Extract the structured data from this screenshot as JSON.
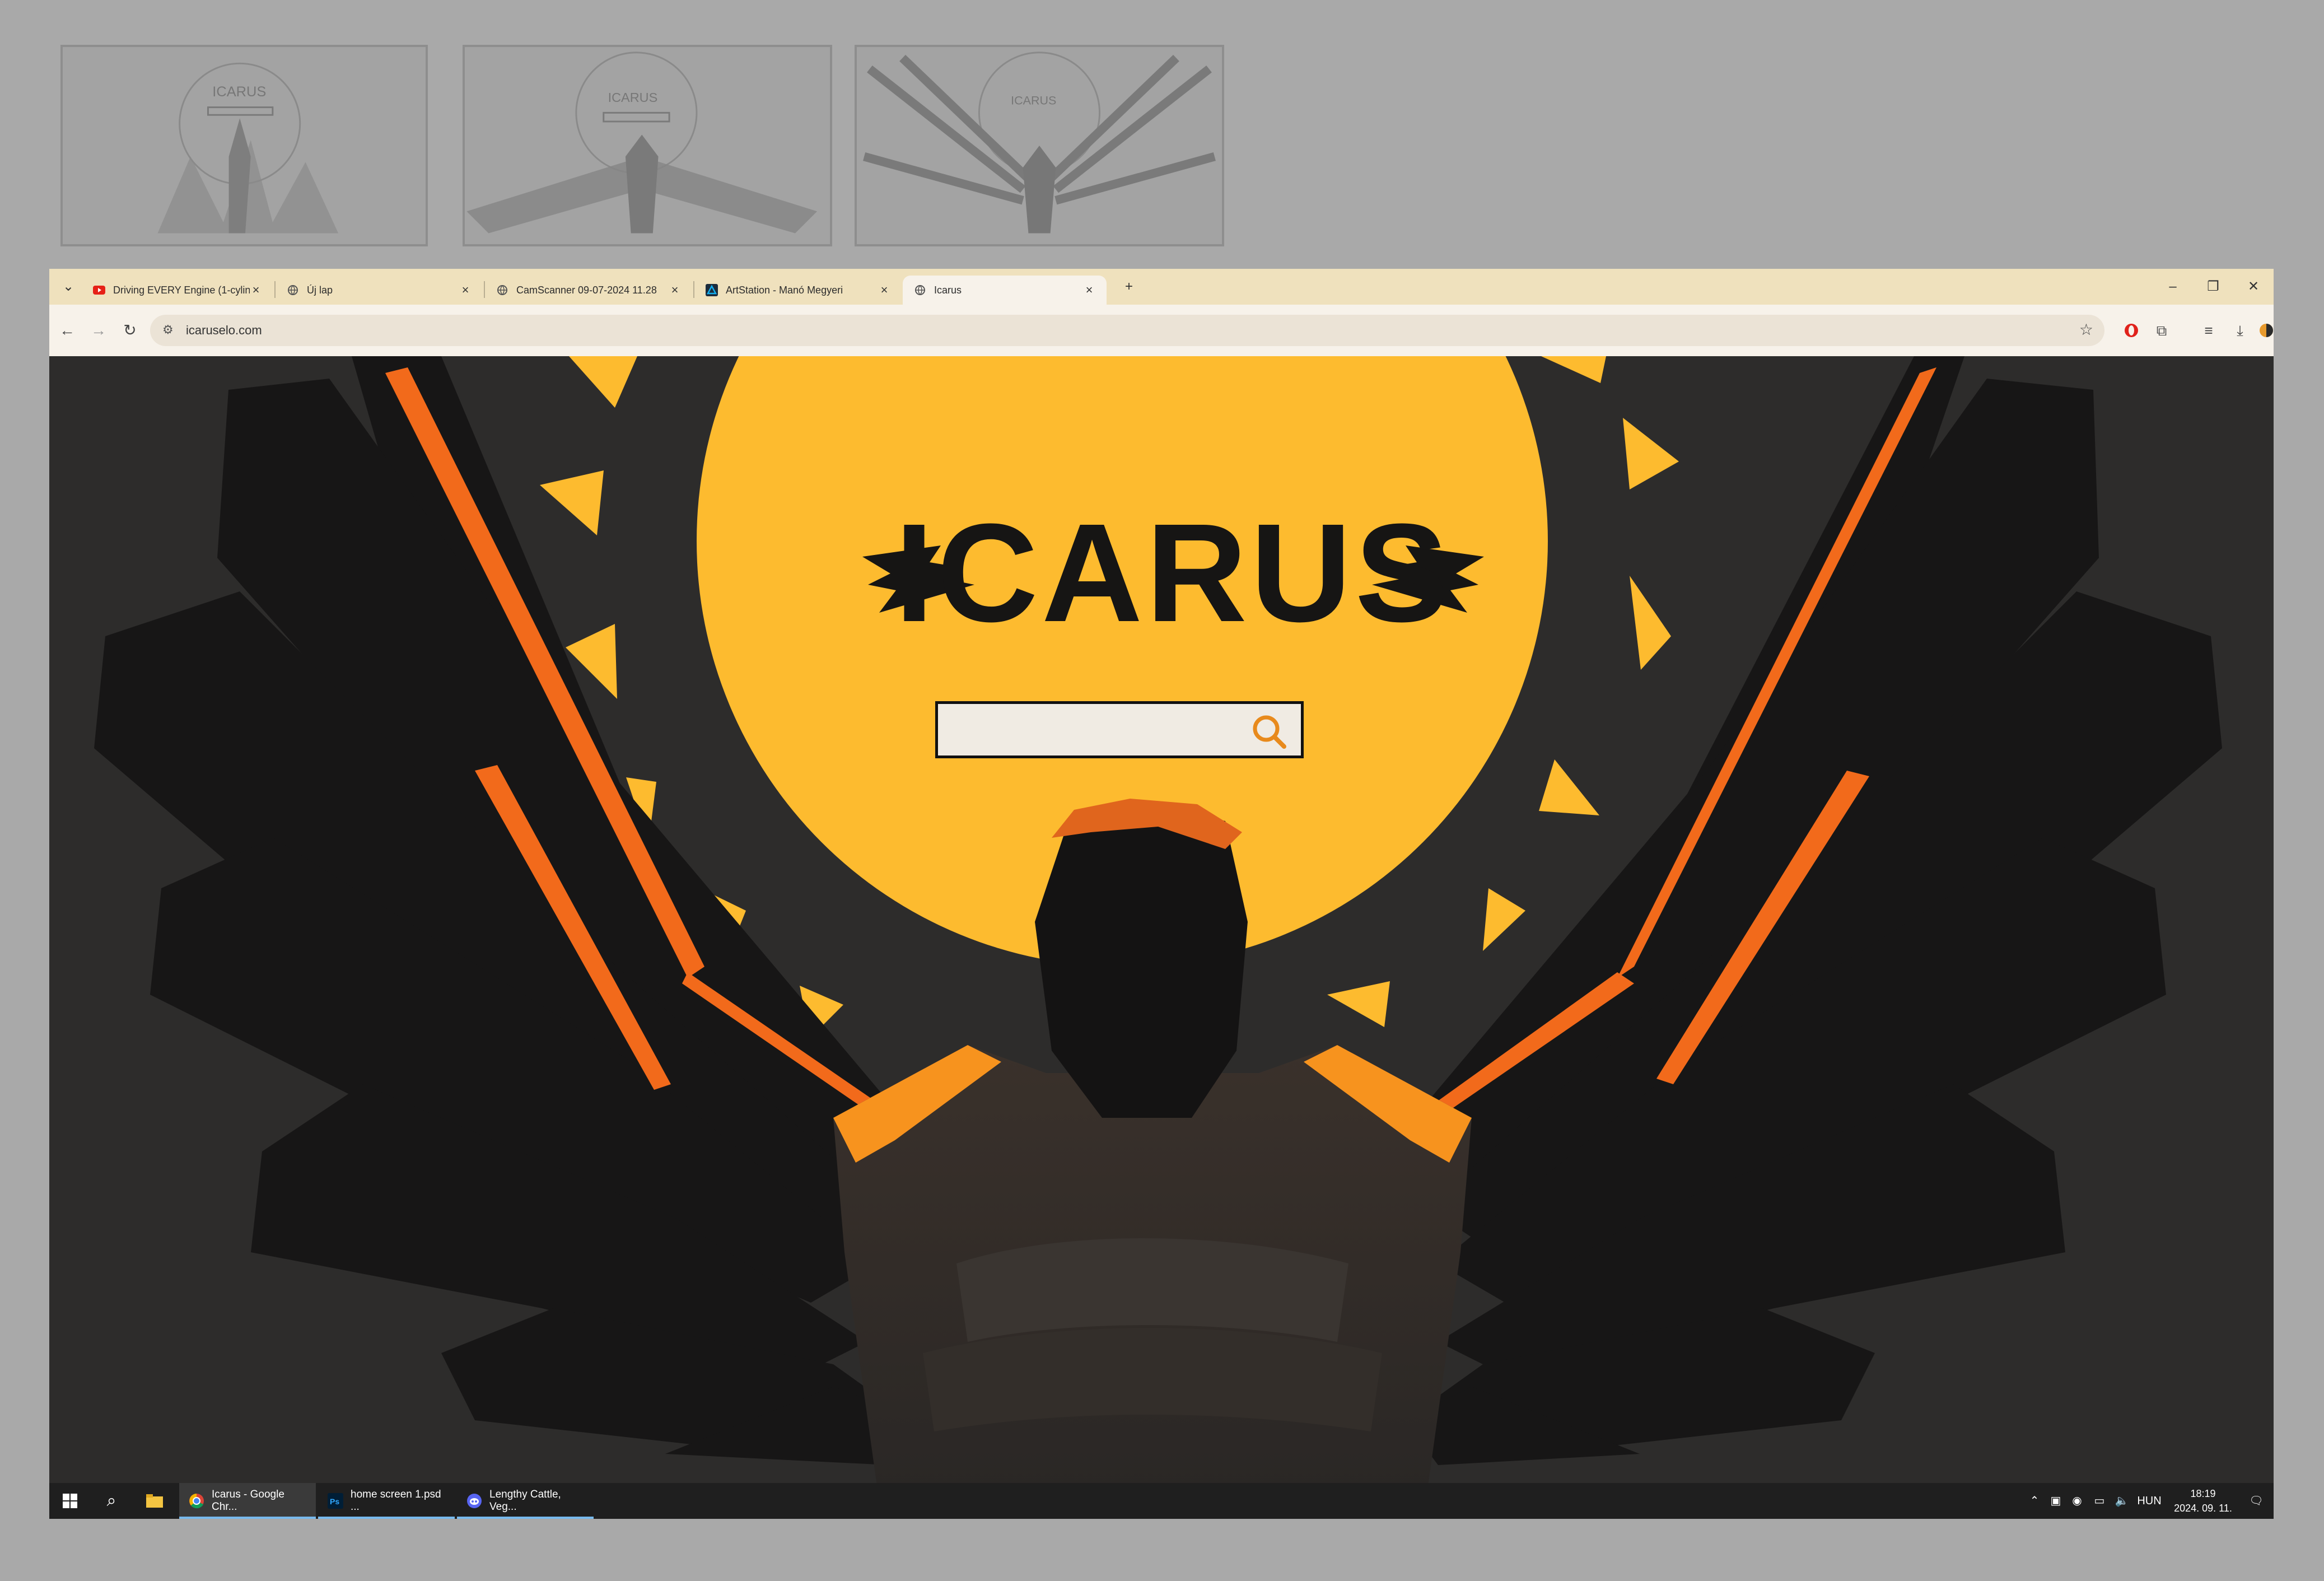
{
  "browser": {
    "tabs": [
      {
        "title": "Driving EVERY Engine (1-cylinde",
        "icon": "youtube-icon"
      },
      {
        "title": "Új lap",
        "icon": "globe-icon"
      },
      {
        "title": "CamScanner 09-07-2024 11.28",
        "icon": "globe-icon"
      },
      {
        "title": "ArtStation - Manó Megyeri",
        "icon": "artstation-icon"
      },
      {
        "title": "Icarus",
        "icon": "globe-icon",
        "active": true
      }
    ],
    "url": "icaruselo.com"
  },
  "page": {
    "logo_text": "ICARUS",
    "search_placeholder": "",
    "colors": {
      "sun": "#fdbb2f",
      "background": "#2d2c2b",
      "accent_orange": "#f26a1b",
      "ink": "#161514"
    }
  },
  "taskbar": {
    "apps": [
      {
        "label": "Icarus - Google Chr...",
        "icon": "chrome-icon",
        "active": true
      },
      {
        "label": "home screen 1.psd ...",
        "icon": "photoshop-icon"
      },
      {
        "label": "Lengthy Cattle, Veg...",
        "icon": "discord-icon"
      }
    ],
    "language": "HUN",
    "time": "18:19",
    "date": "2024. 09. 11."
  }
}
